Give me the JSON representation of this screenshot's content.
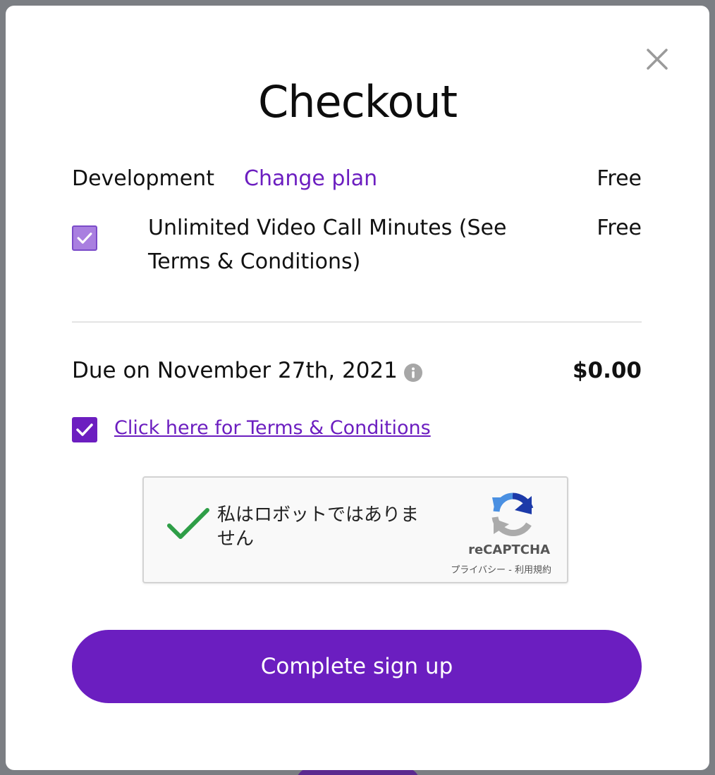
{
  "modal": {
    "title": "Checkout",
    "close_icon": "close-icon"
  },
  "plan": {
    "name": "Development",
    "change_label": "Change plan",
    "price": "Free"
  },
  "addon": {
    "checked": true,
    "label": "Unlimited Video Call Minutes (See Terms & Conditions)",
    "price": "Free"
  },
  "due": {
    "label": "Due on November 27th, 2021",
    "amount": "$0.00",
    "info_icon": "info-icon"
  },
  "terms": {
    "checked": true,
    "link_label": "Click here for Terms & Conditions"
  },
  "captcha": {
    "text": "私はロボットではありません",
    "brand": "reCAPTCHA",
    "privacy": "プライバシー",
    "separator": " - ",
    "terms": "利用規約",
    "state": "verified"
  },
  "cta": {
    "label": "Complete sign up"
  },
  "colors": {
    "accent": "#6c1ec0",
    "check_light": "#a97fe0",
    "captcha_check": "#2e9e47",
    "backdrop": "#7b7e83"
  }
}
